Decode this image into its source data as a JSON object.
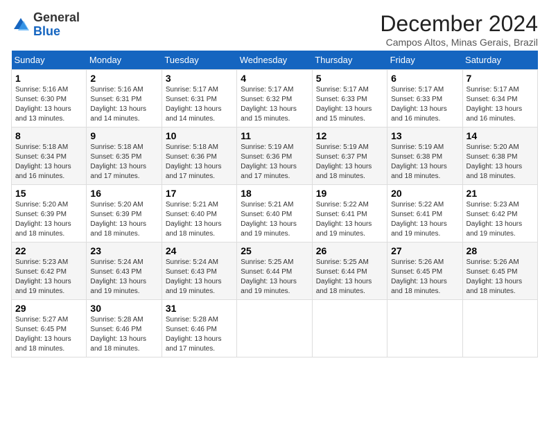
{
  "logo": {
    "general": "General",
    "blue": "Blue"
  },
  "title": "December 2024",
  "subtitle": "Campos Altos, Minas Gerais, Brazil",
  "weekdays": [
    "Sunday",
    "Monday",
    "Tuesday",
    "Wednesday",
    "Thursday",
    "Friday",
    "Saturday"
  ],
  "weeks": [
    [
      {
        "day": "1",
        "sunrise": "5:16 AM",
        "sunset": "6:30 PM",
        "daylight": "13 hours and 13 minutes."
      },
      {
        "day": "2",
        "sunrise": "5:16 AM",
        "sunset": "6:31 PM",
        "daylight": "13 hours and 14 minutes."
      },
      {
        "day": "3",
        "sunrise": "5:17 AM",
        "sunset": "6:31 PM",
        "daylight": "13 hours and 14 minutes."
      },
      {
        "day": "4",
        "sunrise": "5:17 AM",
        "sunset": "6:32 PM",
        "daylight": "13 hours and 15 minutes."
      },
      {
        "day": "5",
        "sunrise": "5:17 AM",
        "sunset": "6:33 PM",
        "daylight": "13 hours and 15 minutes."
      },
      {
        "day": "6",
        "sunrise": "5:17 AM",
        "sunset": "6:33 PM",
        "daylight": "13 hours and 16 minutes."
      },
      {
        "day": "7",
        "sunrise": "5:17 AM",
        "sunset": "6:34 PM",
        "daylight": "13 hours and 16 minutes."
      }
    ],
    [
      {
        "day": "8",
        "sunrise": "5:18 AM",
        "sunset": "6:34 PM",
        "daylight": "13 hours and 16 minutes."
      },
      {
        "day": "9",
        "sunrise": "5:18 AM",
        "sunset": "6:35 PM",
        "daylight": "13 hours and 17 minutes."
      },
      {
        "day": "10",
        "sunrise": "5:18 AM",
        "sunset": "6:36 PM",
        "daylight": "13 hours and 17 minutes."
      },
      {
        "day": "11",
        "sunrise": "5:19 AM",
        "sunset": "6:36 PM",
        "daylight": "13 hours and 17 minutes."
      },
      {
        "day": "12",
        "sunrise": "5:19 AM",
        "sunset": "6:37 PM",
        "daylight": "13 hours and 18 minutes."
      },
      {
        "day": "13",
        "sunrise": "5:19 AM",
        "sunset": "6:38 PM",
        "daylight": "13 hours and 18 minutes."
      },
      {
        "day": "14",
        "sunrise": "5:20 AM",
        "sunset": "6:38 PM",
        "daylight": "13 hours and 18 minutes."
      }
    ],
    [
      {
        "day": "15",
        "sunrise": "5:20 AM",
        "sunset": "6:39 PM",
        "daylight": "13 hours and 18 minutes."
      },
      {
        "day": "16",
        "sunrise": "5:20 AM",
        "sunset": "6:39 PM",
        "daylight": "13 hours and 18 minutes."
      },
      {
        "day": "17",
        "sunrise": "5:21 AM",
        "sunset": "6:40 PM",
        "daylight": "13 hours and 18 minutes."
      },
      {
        "day": "18",
        "sunrise": "5:21 AM",
        "sunset": "6:40 PM",
        "daylight": "13 hours and 19 minutes."
      },
      {
        "day": "19",
        "sunrise": "5:22 AM",
        "sunset": "6:41 PM",
        "daylight": "13 hours and 19 minutes."
      },
      {
        "day": "20",
        "sunrise": "5:22 AM",
        "sunset": "6:41 PM",
        "daylight": "13 hours and 19 minutes."
      },
      {
        "day": "21",
        "sunrise": "5:23 AM",
        "sunset": "6:42 PM",
        "daylight": "13 hours and 19 minutes."
      }
    ],
    [
      {
        "day": "22",
        "sunrise": "5:23 AM",
        "sunset": "6:42 PM",
        "daylight": "13 hours and 19 minutes."
      },
      {
        "day": "23",
        "sunrise": "5:24 AM",
        "sunset": "6:43 PM",
        "daylight": "13 hours and 19 minutes."
      },
      {
        "day": "24",
        "sunrise": "5:24 AM",
        "sunset": "6:43 PM",
        "daylight": "13 hours and 19 minutes."
      },
      {
        "day": "25",
        "sunrise": "5:25 AM",
        "sunset": "6:44 PM",
        "daylight": "13 hours and 19 minutes."
      },
      {
        "day": "26",
        "sunrise": "5:25 AM",
        "sunset": "6:44 PM",
        "daylight": "13 hours and 18 minutes."
      },
      {
        "day": "27",
        "sunrise": "5:26 AM",
        "sunset": "6:45 PM",
        "daylight": "13 hours and 18 minutes."
      },
      {
        "day": "28",
        "sunrise": "5:26 AM",
        "sunset": "6:45 PM",
        "daylight": "13 hours and 18 minutes."
      }
    ],
    [
      {
        "day": "29",
        "sunrise": "5:27 AM",
        "sunset": "6:45 PM",
        "daylight": "13 hours and 18 minutes."
      },
      {
        "day": "30",
        "sunrise": "5:28 AM",
        "sunset": "6:46 PM",
        "daylight": "13 hours and 18 minutes."
      },
      {
        "day": "31",
        "sunrise": "5:28 AM",
        "sunset": "6:46 PM",
        "daylight": "13 hours and 17 minutes."
      },
      null,
      null,
      null,
      null
    ]
  ]
}
